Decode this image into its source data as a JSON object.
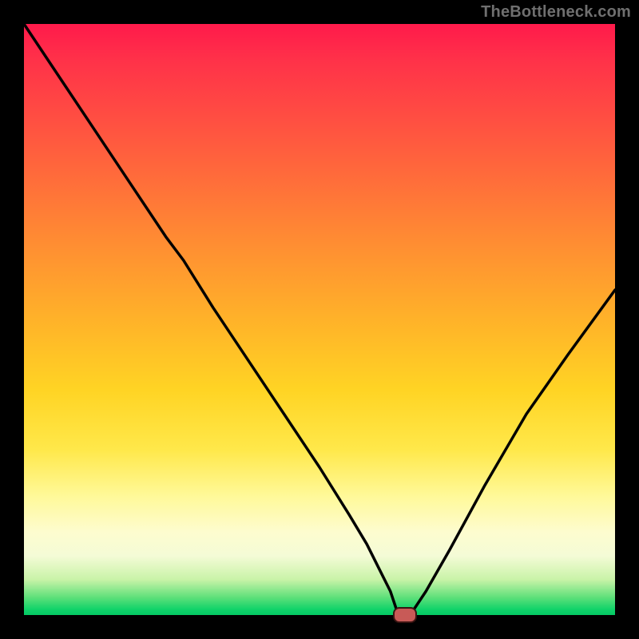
{
  "attribution": "TheBottleneck.com",
  "colors": {
    "frame_bg": "#000000",
    "attrib_text": "#6f6f6f",
    "curve": "#000000",
    "marker_fill": "#c85a57",
    "marker_border": "#3a1412"
  },
  "chart_data": {
    "type": "line",
    "title": "",
    "xlabel": "",
    "ylabel": "",
    "xlim": [
      0,
      100
    ],
    "ylim": [
      0,
      100
    ],
    "grid": false,
    "legend": false,
    "series": [
      {
        "name": "bottleneck-curve",
        "x": [
          0,
          6,
          12,
          18,
          24,
          27,
          32,
          38,
          44,
          50,
          55,
          58,
          60,
          62,
          63,
          64.5,
          66,
          68,
          72,
          78,
          85,
          92,
          100
        ],
        "y": [
          100,
          91,
          82,
          73,
          64,
          60,
          52,
          43,
          34,
          25,
          17,
          12,
          8,
          4,
          1,
          0,
          1,
          4,
          11,
          22,
          34,
          44,
          55
        ]
      }
    ],
    "marker": {
      "x": 64.5,
      "y": 0,
      "shape": "pill"
    },
    "notes": "Plot has no visible axis ticks or labels; background is a vertical red→yellow→green gradient. Curve descends steeply from top-left, minimum around x≈64.5, then rises to the right."
  }
}
